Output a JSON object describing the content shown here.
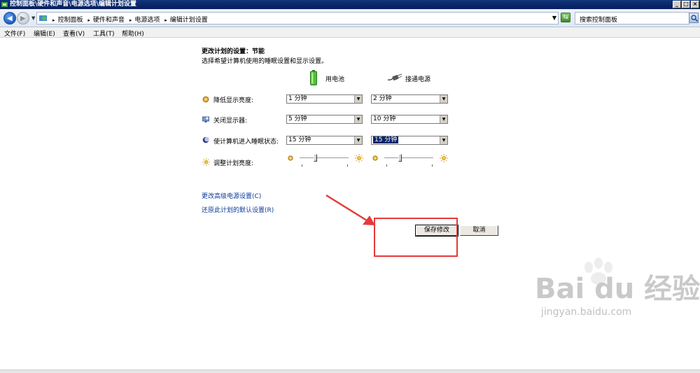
{
  "window": {
    "title": "控制面板\\硬件和声音\\电源选项\\编辑计划设置",
    "minimize": "_",
    "maximize": "□",
    "close": "×"
  },
  "address": {
    "crumbs": [
      "控制面板",
      "硬件和声音",
      "电源选项",
      "编辑计划设置"
    ],
    "search_placeholder": "搜索控制面板"
  },
  "menu": [
    "文件(F)",
    "编辑(E)",
    "查看(V)",
    "工具(T)",
    "帮助(H)"
  ],
  "page": {
    "title": "更改计划的设置：节能",
    "subtitle": "选择希望计算机使用的睡眠设置和显示设置。",
    "col_battery": "用电池",
    "col_plugged": "接通电源"
  },
  "settings": [
    {
      "label": "降低显示亮度:",
      "battery": "1 分钟",
      "plugged": "2 分钟"
    },
    {
      "label": "关闭显示器:",
      "battery": "5 分钟",
      "plugged": "10 分钟"
    },
    {
      "label": "使计算机进入睡眠状态:",
      "battery": "15 分钟",
      "plugged": "15 分钟"
    }
  ],
  "brightness": {
    "label": "调整计划亮度:",
    "battery_level": 0.25,
    "plugged_level": 0.25
  },
  "links": {
    "advanced": "更改高级电源设置(C)",
    "restore": "还原此计划的默认设置(R)"
  },
  "buttons": {
    "save": "保存修改",
    "cancel": "取消"
  },
  "watermark": {
    "text": "Bai du 经验",
    "url": "jingyan.baidu.com"
  },
  "colors": {
    "annotation": "#e53a3a",
    "link": "#0b3a9a",
    "focus": "#0a246a"
  }
}
